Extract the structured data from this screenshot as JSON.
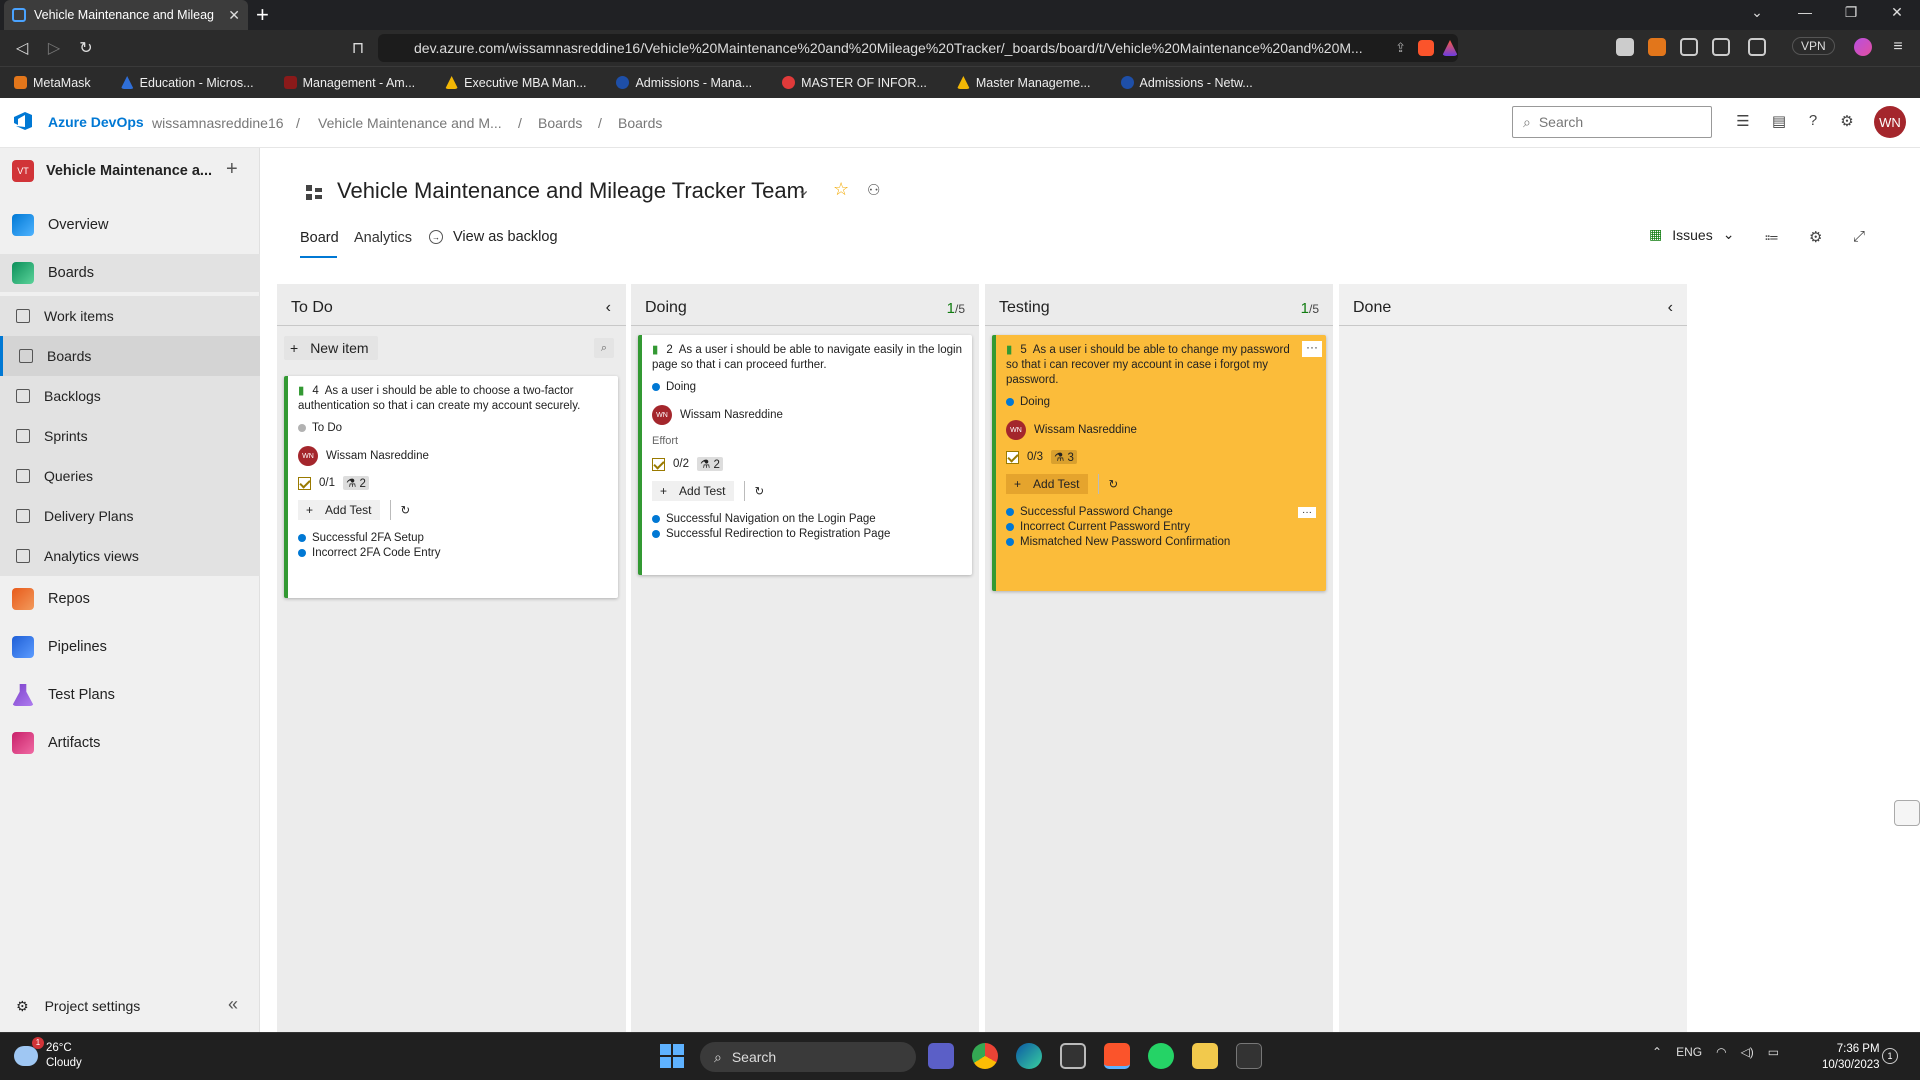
{
  "browser": {
    "tab_title": "Vehicle Maintenance and Mileag",
    "url": "dev.azure.com/wissamnasreddine16/Vehicle%20Maintenance%20and%20Mileage%20Tracker/_boards/board/t/Vehicle%20Maintenance%20and%20M...",
    "vpn_label": "VPN",
    "bookmarks": [
      "MetaMask",
      "Education - Micros...",
      "Management - Am...",
      "Executive MBA Man...",
      "Admissions - Mana...",
      "MASTER OF INFOR...",
      "Master Manageme...",
      "Admissions - Netw..."
    ]
  },
  "header": {
    "brand": "Azure DevOps",
    "org": "wissamnasreddine16",
    "crumb_project": "Vehicle Maintenance and M...",
    "crumb_boards1": "Boards",
    "crumb_boards2": "Boards",
    "sep": "/",
    "search_placeholder": "Search",
    "avatar_initials": "WN"
  },
  "sidebar": {
    "project_initials": "VT",
    "project_name": "Vehicle Maintenance a...",
    "items": [
      "Overview",
      "Boards",
      "Work items",
      "Boards",
      "Backlogs",
      "Sprints",
      "Queries",
      "Delivery Plans",
      "Analytics views",
      "Repos",
      "Pipelines",
      "Test Plans",
      "Artifacts"
    ],
    "settings_label": "Project settings"
  },
  "team": {
    "name": "Vehicle Maintenance and Mileage Tracker Team",
    "tab_board": "Board",
    "tab_analytics": "Analytics",
    "view_backlog": "View as backlog",
    "backlog_level": "Issues"
  },
  "columns": {
    "todo": {
      "title": "To Do"
    },
    "doing": {
      "title": "Doing",
      "count": "1",
      "limit": "/5"
    },
    "testing": {
      "title": "Testing",
      "count": "1",
      "limit": "/5"
    },
    "done": {
      "title": "Done"
    }
  },
  "new_item": "New item",
  "cards": {
    "c4": {
      "id": "4",
      "title": "As a user i should be able to choose a two-factor authentication so that i can create my account securely.",
      "state": "To Do",
      "owner": "Wissam Nasreddine",
      "owner_initials": "WN",
      "tasks": "0/1",
      "tests_count": "2",
      "add_test": "Add Test",
      "tests": [
        "Successful 2FA Setup",
        "Incorrect 2FA Code Entry"
      ]
    },
    "c2": {
      "id": "2",
      "title": "As a user i should be able to navigate easily in the login page so that i can proceed further.",
      "state": "Doing",
      "owner": "Wissam Nasreddine",
      "owner_initials": "WN",
      "effort_label": "Effort",
      "tasks": "0/2",
      "tests_count": "2",
      "add_test": "Add Test",
      "tests": [
        "Successful Navigation on the Login Page",
        "Successful Redirection to Registration Page"
      ]
    },
    "c5": {
      "id": "5",
      "title": "As a user i should be able to change my password so that i can recover my account in case i forgot my password.",
      "state": "Doing",
      "owner": "Wissam Nasreddine",
      "owner_initials": "WN",
      "tasks": "0/3",
      "tests_count": "3",
      "add_test": "Add Test",
      "more": "···",
      "tests": [
        "Successful Password Change",
        "Incorrect Current Password Entry",
        "Mismatched New Password Confirmation"
      ]
    }
  },
  "taskbar": {
    "weather_temp": "26°C",
    "weather_cond": "Cloudy",
    "weather_badge": "1",
    "search_label": "Search",
    "lang": "ENG",
    "time": "7:36 PM",
    "date": "10/30/2023"
  },
  "colors": {
    "accent": "#0078d4",
    "story_green": "#339933",
    "card_yellow": "#fbbc3a",
    "doing_dot": "#0078d4",
    "todo_dot": "#b2b2b2",
    "avatar_red": "#a4262c"
  }
}
